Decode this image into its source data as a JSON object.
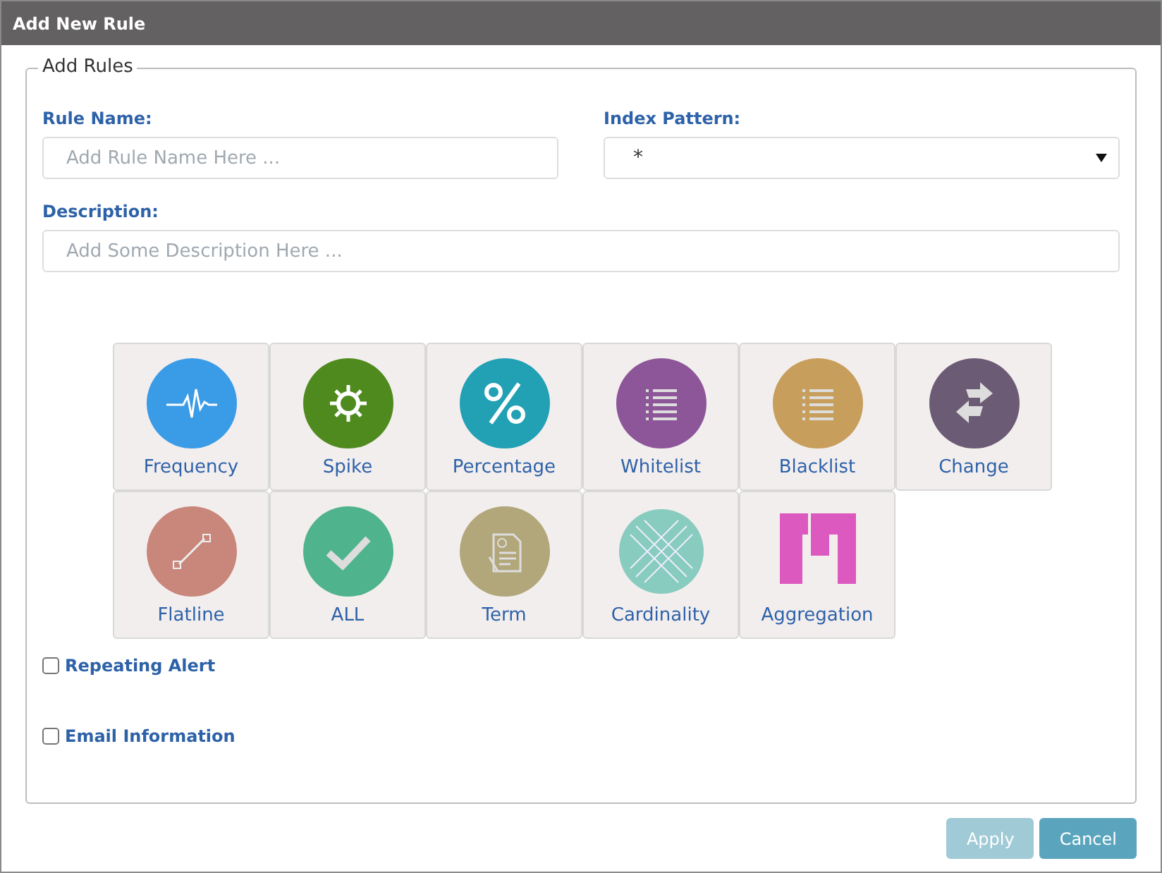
{
  "window": {
    "title": "Add New Rule"
  },
  "form": {
    "legend": "Add Rules",
    "rule_name": {
      "label": "Rule Name:",
      "placeholder": "Add Rule Name Here ..."
    },
    "index_pattern": {
      "label": "Index Pattern:",
      "value": "*"
    },
    "description": {
      "label": "Description:",
      "placeholder": "Add Some Description Here ..."
    }
  },
  "rule_types": [
    {
      "label": "Frequency",
      "kind": "pulse",
      "color": "#3a9be6"
    },
    {
      "label": "Spike",
      "kind": "gear",
      "color": "#4f8a1f"
    },
    {
      "label": "Percentage",
      "kind": "percent",
      "color": "#22a0b4"
    },
    {
      "label": "Whitelist",
      "kind": "list",
      "color": "#8c5699"
    },
    {
      "label": "Blacklist",
      "kind": "list",
      "color": "#c79e5b"
    },
    {
      "label": "Change",
      "kind": "swap",
      "color": "#6c5b74"
    },
    {
      "label": "Flatline",
      "kind": "line",
      "color": "#c9867b"
    },
    {
      "label": "ALL",
      "kind": "check",
      "color": "#4fb38d"
    },
    {
      "label": "Term",
      "kind": "document",
      "color": "#b2a77a"
    },
    {
      "label": "Cardinality",
      "kind": "lattice",
      "color": "#88cbbf"
    },
    {
      "label": "Aggregation",
      "kind": "blocks",
      "color": "#dc5ac0"
    }
  ],
  "options": [
    {
      "label": "Repeating Alert",
      "checked": false
    },
    {
      "label": "Email Information",
      "checked": false
    }
  ],
  "buttons": [
    {
      "label": "Apply",
      "disabled": true
    },
    {
      "label": "Cancel",
      "disabled": false
    }
  ]
}
